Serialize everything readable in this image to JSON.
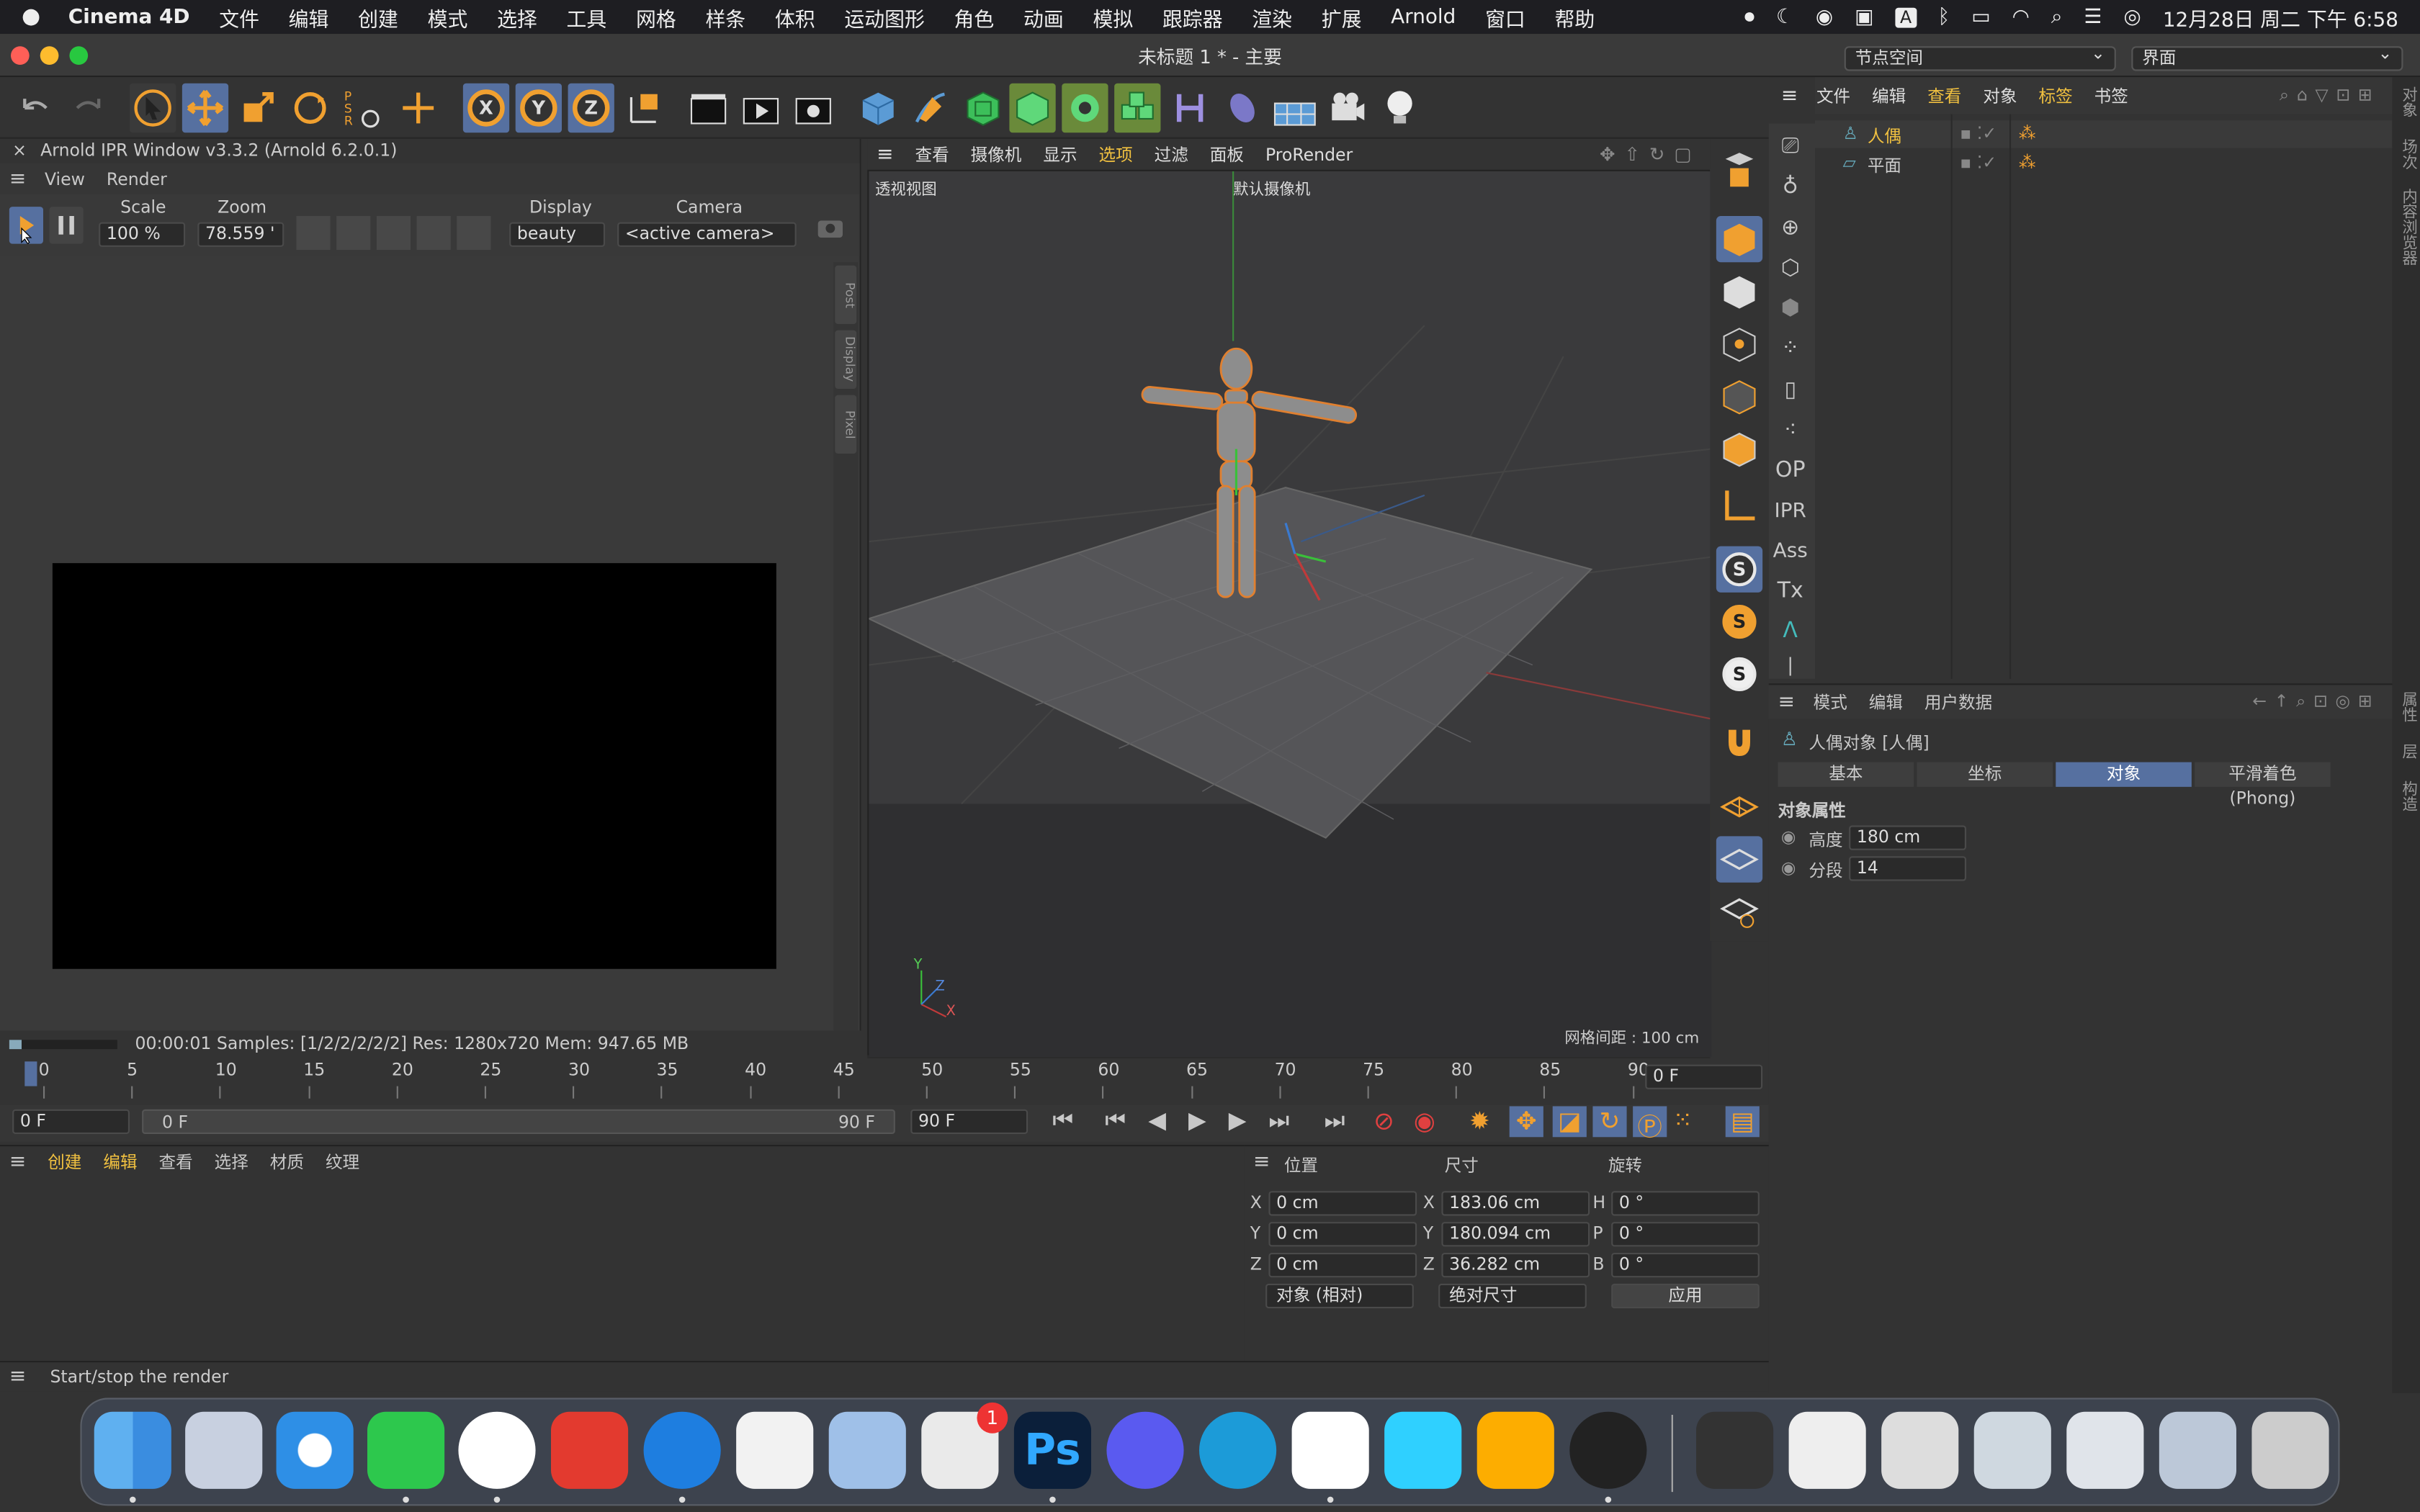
{
  "menubar": {
    "app": "Cinema 4D",
    "items": [
      "文件",
      "编辑",
      "创建",
      "模式",
      "选择",
      "工具",
      "网格",
      "样条",
      "体积",
      "运动图形",
      "角色",
      "动画",
      "模拟",
      "跟踪器",
      "渲染",
      "扩展",
      "Arnold",
      "窗口",
      "帮助"
    ],
    "clock": "12月28日 周二 下午 6:58"
  },
  "window": {
    "title": "未标题 1 * - 主要",
    "node_space": "节点空间",
    "layout": "界面"
  },
  "ipr": {
    "title": "Arnold IPR Window v3.3.2 (Arnold 6.2.0.1)",
    "menu": [
      "View",
      "Render"
    ],
    "scale_label": "Scale",
    "scale_value": "100 %",
    "zoom_label": "Zoom",
    "zoom_value": "78.559 '",
    "display_label": "Display",
    "display_value": "beauty",
    "camera_label": "Camera",
    "camera_value": "<active camera>",
    "side_tabs": [
      "Post",
      "Display",
      "Pixel"
    ],
    "status": "00:00:01  Samples: [1/2/2/2/2/2]  Res: 1280x720  Mem: 947.65 MB"
  },
  "viewport": {
    "menu": [
      "查看",
      "摄像机",
      "显示",
      "选项",
      "过滤",
      "面板",
      "ProRender"
    ],
    "view_name": "透视视图",
    "camera_name": "默认摄像机",
    "grid_spacing": "网格间距 : 100 cm",
    "axis_y": "Y",
    "axis_z": "Z",
    "axis_x": "X"
  },
  "objects": {
    "menu": [
      "文件",
      "编辑",
      "查看",
      "对象",
      "标签",
      "书签"
    ],
    "items": [
      {
        "name": "人偶",
        "color": "#f0c040"
      },
      {
        "name": "平面",
        "color": "#cccccc"
      }
    ]
  },
  "attributes": {
    "menu": [
      "模式",
      "编辑",
      "用户数据"
    ],
    "object_title": "人偶对象 [人偶]",
    "tabs": [
      "基本",
      "坐标",
      "对象",
      "平滑着色 (Phong)"
    ],
    "section": "对象属性",
    "props": [
      {
        "label": "高度",
        "value": "180 cm"
      },
      {
        "label": "分段",
        "value": "14"
      }
    ]
  },
  "right_strip": [
    "对象",
    "场次",
    "内容浏览器",
    "属性",
    "层",
    "构造"
  ],
  "timeline": {
    "ticks": [
      "0",
      "5",
      "10",
      "15",
      "20",
      "25",
      "30",
      "35",
      "40",
      "45",
      "50",
      "55",
      "60",
      "65",
      "70",
      "75",
      "80",
      "85",
      "90"
    ],
    "frame_field": "0 F",
    "start": "0 F",
    "range_start": "0 F",
    "range_end": "90 F",
    "end": "90 F"
  },
  "materials": {
    "menu": [
      "创建",
      "编辑",
      "查看",
      "选择",
      "材质",
      "纹理"
    ]
  },
  "coords": {
    "headers": [
      "位置",
      "尺寸",
      "旋转"
    ],
    "rows": [
      {
        "a": "X",
        "pos": "0 cm",
        "b": "X",
        "size": "183.06 cm",
        "c": "H",
        "rot": "0 °"
      },
      {
        "a": "Y",
        "pos": "0 cm",
        "b": "Y",
        "size": "180.094 cm",
        "c": "P",
        "rot": "0 °"
      },
      {
        "a": "Z",
        "pos": "0 cm",
        "b": "Z",
        "size": "36.282 cm",
        "c": "B",
        "rot": "0 °"
      }
    ],
    "mode1": "对象 (相对)",
    "mode2": "绝对尺寸",
    "apply": "应用"
  },
  "statusbar": "Start/stop the render",
  "dock": {
    "badge": "1"
  },
  "toolbar_icons": [
    "undo-icon",
    "redo-icon",
    "select-icon",
    "move-icon",
    "scale-icon",
    "rotate-icon",
    "psr-icon",
    "axis-icon",
    "x-axis-icon",
    "y-axis-icon",
    "z-axis-icon",
    "coordinate-icon",
    "render-region-icon",
    "render-view-icon",
    "render-settings-icon",
    "cube-icon",
    "pen-icon",
    "subdivision-icon",
    "extrude-icon",
    "cloner-icon",
    "array-icon",
    "deformer-icon",
    "field-icon",
    "floor-icon",
    "camera-icon",
    "light-icon"
  ]
}
